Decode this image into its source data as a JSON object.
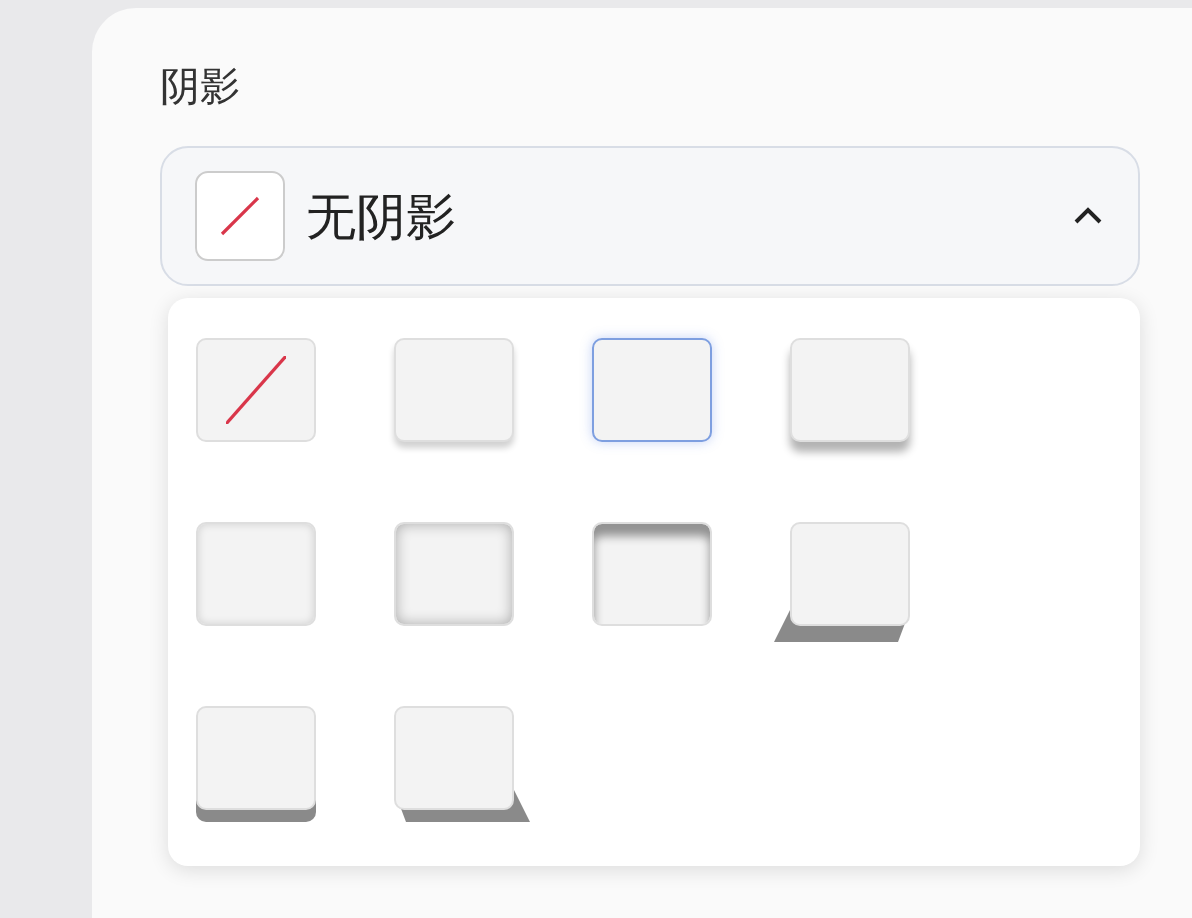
{
  "section_label": "阴影",
  "dropdown": {
    "value": "无阴影",
    "expanded": true
  },
  "options": [
    {
      "kind": "none",
      "selected": false
    },
    {
      "kind": "outer-soft",
      "selected": false
    },
    {
      "kind": "outer-glow",
      "selected": true
    },
    {
      "kind": "outer-bottom",
      "selected": false
    },
    {
      "kind": "inner-soft",
      "selected": false
    },
    {
      "kind": "inner-all",
      "selected": false
    },
    {
      "kind": "inner-top",
      "selected": false
    },
    {
      "kind": "perspective-left",
      "selected": false
    },
    {
      "kind": "floor",
      "selected": false
    },
    {
      "kind": "perspective-right",
      "selected": false
    }
  ]
}
